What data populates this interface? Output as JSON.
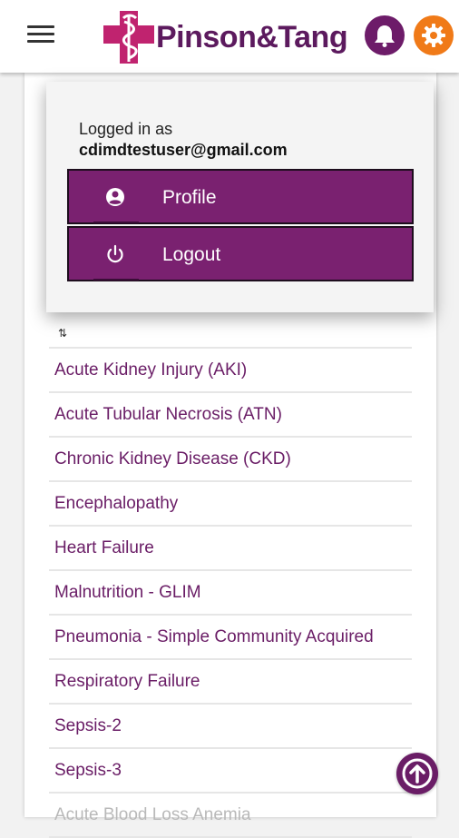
{
  "header": {
    "brand": "Pinson&Tang",
    "menu_icon": "hamburger-icon",
    "notifications_icon": "bell-icon",
    "settings_icon": "gear-icon",
    "colors": {
      "brand_purple": "#5c1a5e",
      "bell_bg": "#6d1c69",
      "settings_bg": "#f07a18",
      "logo_pink": "#c0236f"
    }
  },
  "user_menu": {
    "logged_in_label": "Logged in as",
    "email": "cdimdtestuser@gmail.com",
    "items": [
      {
        "label": "Profile",
        "icon": "account-circle-icon"
      },
      {
        "label": "Logout",
        "icon": "power-icon"
      }
    ],
    "button_color": "#7a2170"
  },
  "list": {
    "sort_icon": "sort-icon",
    "items": [
      "Acute Kidney Injury (AKI)",
      "Acute Tubular Necrosis (ATN)",
      "Chronic Kidney Disease (CKD)",
      "Encephalopathy",
      "Heart Failure",
      "Malnutrition - GLIM",
      "Pneumonia - Simple Community Acquired",
      "Respiratory Failure",
      "Sepsis-2",
      "Sepsis-3",
      "Acute Blood Loss Anemia"
    ]
  },
  "scroll_top_icon": "arrow-up-circle-icon"
}
